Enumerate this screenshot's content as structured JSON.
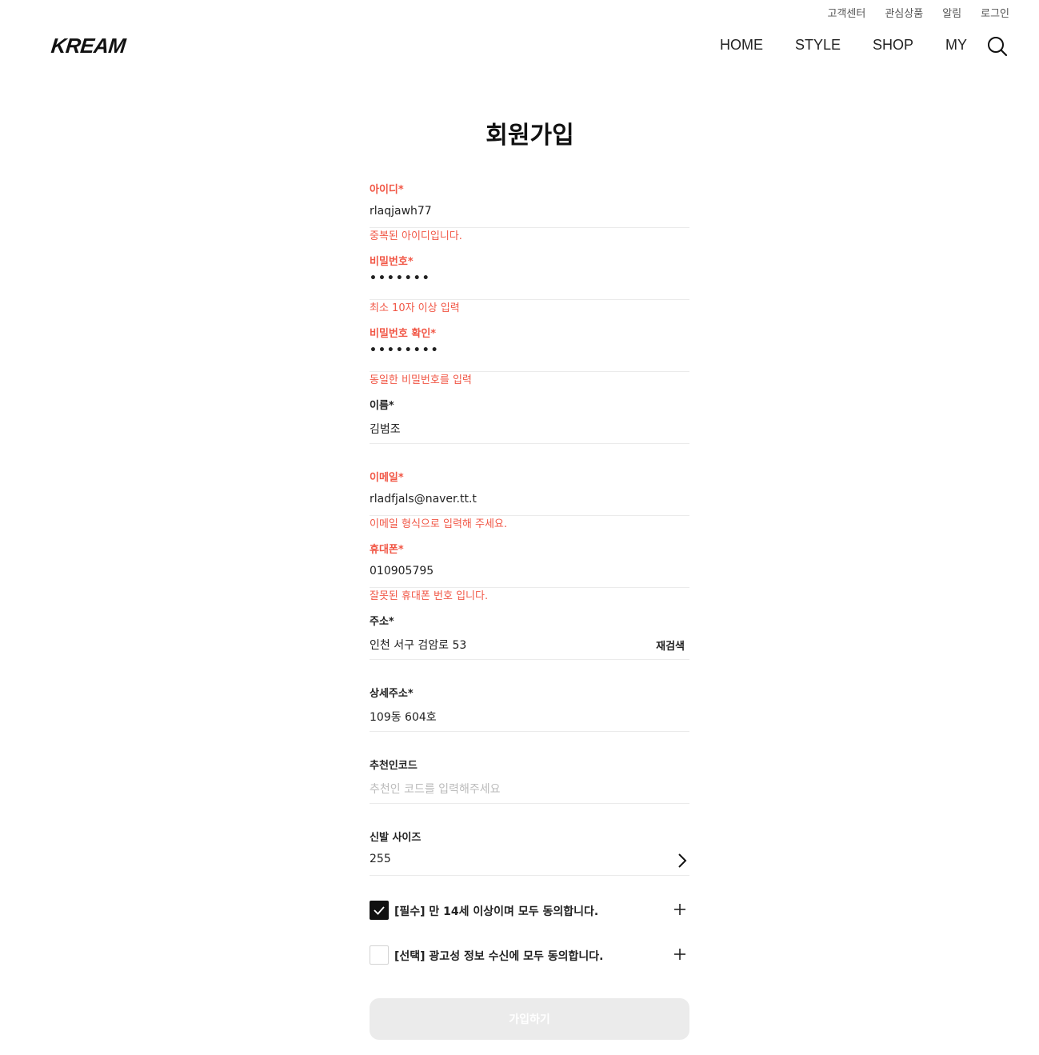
{
  "top_links": [
    "고객센터",
    "관심상품",
    "알림",
    "로그인"
  ],
  "logo": "KREAM",
  "nav": [
    "HOME",
    "STYLE",
    "SHOP",
    "MY"
  ],
  "search_icon": "search-icon",
  "title": "회원가입",
  "fields": {
    "id": {
      "label": "아이디*",
      "value": "rlaqjawh77",
      "message": "중복된 아이디입니다."
    },
    "password": {
      "label": "비밀번호*",
      "value": "•••••••",
      "message": "최소 10자 이상 입력"
    },
    "password_confirm": {
      "label": "비밀번호 확인*",
      "value": "••••••••",
      "message": "동일한 비밀번호를 입력"
    },
    "name": {
      "label": "이름*",
      "value": "김범조"
    },
    "email": {
      "label": "이메일*",
      "value": "rladfjals@naver.tt.t",
      "message": "이메일 형식으로 입력해 주세요."
    },
    "phone": {
      "label": "휴대폰*",
      "value": "010905795",
      "message": "잘못된 휴대폰 번호 입니다."
    },
    "address": {
      "label": "주소*",
      "value": "인천 서구 검암로 53",
      "button": "재검색"
    },
    "address_detail": {
      "label": "상세주소*",
      "value": "109동 604호"
    },
    "referral": {
      "label": "추천인코드",
      "placeholder": "추천인 코드를 입력해주세요"
    },
    "shoe_size": {
      "label": "신발 사이즈",
      "value": "255"
    }
  },
  "agreements": [
    {
      "text": "[필수] 만 14세 이상이며 모두 동의합니다.",
      "checked": true
    },
    {
      "text": "[선택] 광고성 정보 수신에 모두 동의합니다.",
      "checked": false
    }
  ],
  "submit_label": "가입하기",
  "colors": {
    "error": "#f15746",
    "divider": "#ebebeb",
    "disabled_button": "#ebebeb",
    "text": "#222222"
  }
}
